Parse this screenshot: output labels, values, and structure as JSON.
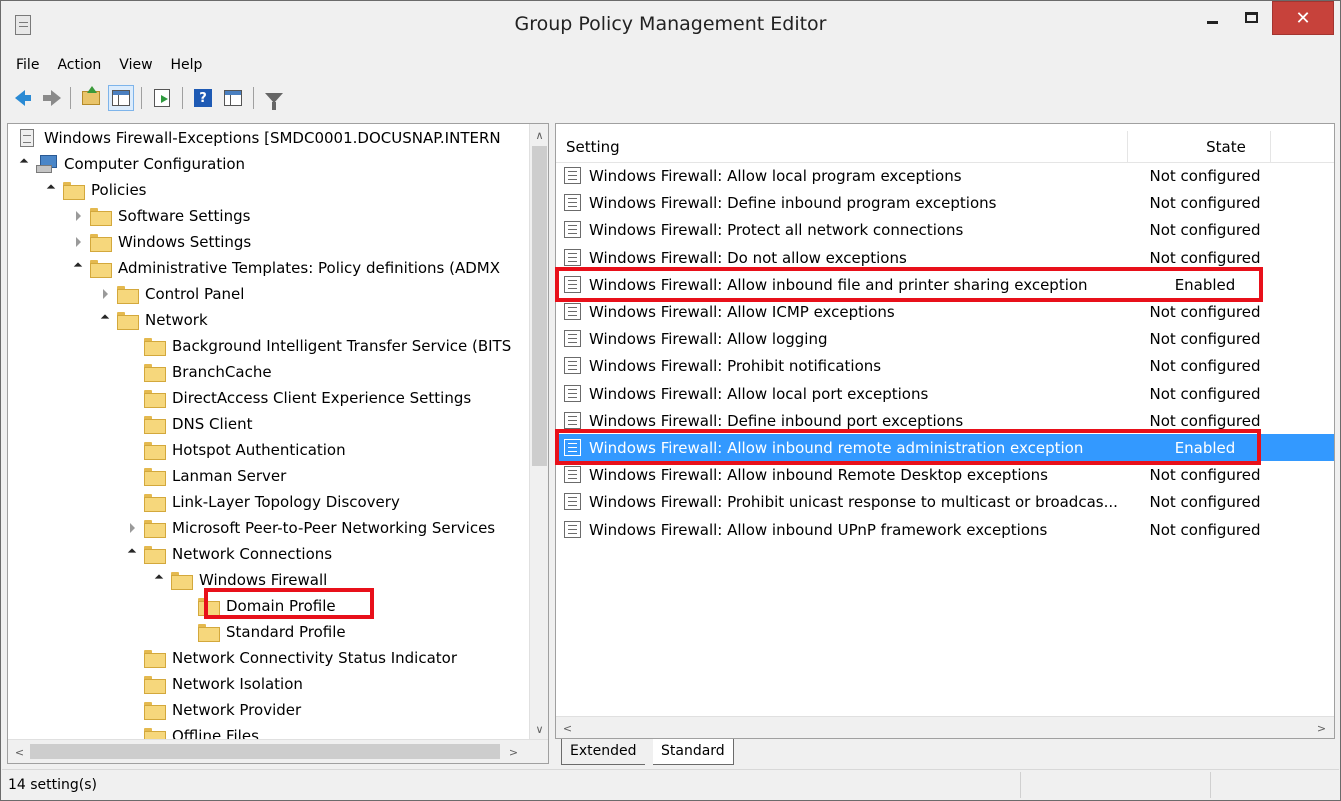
{
  "window": {
    "title": "Group Policy Management Editor",
    "close_glyph": "✕"
  },
  "menu": [
    "File",
    "Action",
    "View",
    "Help"
  ],
  "toolbar": {
    "help_glyph": "?"
  },
  "tree": {
    "items": [
      {
        "label": "Windows Firewall-Exceptions [SMDC0001.DOCUSNAP.INTERN",
        "icon": "gpo-icon",
        "expander": "none",
        "level": 0
      },
      {
        "label": "Computer Configuration",
        "icon": "computer-icon",
        "expander": "open",
        "level": 0
      },
      {
        "label": "Policies",
        "icon": "folder-icon",
        "expander": "open",
        "level": 1
      },
      {
        "label": "Software Settings",
        "icon": "folder-icon",
        "expander": "closed",
        "level": 2
      },
      {
        "label": "Windows Settings",
        "icon": "folder-icon",
        "expander": "closed",
        "level": 2
      },
      {
        "label": "Administrative Templates: Policy definitions (ADMX",
        "icon": "folder-icon",
        "expander": "open",
        "level": 2
      },
      {
        "label": "Control Panel",
        "icon": "folder-icon",
        "expander": "closed",
        "level": 3
      },
      {
        "label": "Network",
        "icon": "folder-icon",
        "expander": "open",
        "level": 3
      },
      {
        "label": "Background Intelligent Transfer Service (BITS",
        "icon": "folder-icon",
        "expander": "none",
        "level": 4
      },
      {
        "label": "BranchCache",
        "icon": "folder-icon",
        "expander": "none",
        "level": 4
      },
      {
        "label": "DirectAccess Client Experience Settings",
        "icon": "folder-icon",
        "expander": "none",
        "level": 4
      },
      {
        "label": "DNS Client",
        "icon": "folder-icon",
        "expander": "none",
        "level": 4
      },
      {
        "label": "Hotspot Authentication",
        "icon": "folder-icon",
        "expander": "none",
        "level": 4
      },
      {
        "label": "Lanman Server",
        "icon": "folder-icon",
        "expander": "none",
        "level": 4
      },
      {
        "label": "Link-Layer Topology Discovery",
        "icon": "folder-icon",
        "expander": "none",
        "level": 4
      },
      {
        "label": "Microsoft Peer-to-Peer Networking Services",
        "icon": "folder-icon",
        "expander": "closed",
        "level": 4
      },
      {
        "label": "Network Connections",
        "icon": "folder-icon",
        "expander": "open",
        "level": 4
      },
      {
        "label": "Windows Firewall",
        "icon": "folder-icon",
        "expander": "open",
        "level": 5
      },
      {
        "label": "Domain Profile",
        "icon": "folder-icon",
        "expander": "none",
        "level": 6
      },
      {
        "label": "Standard Profile",
        "icon": "folder-icon",
        "expander": "none",
        "level": 6
      },
      {
        "label": "Network Connectivity Status Indicator",
        "icon": "folder-icon",
        "expander": "none",
        "level": 4
      },
      {
        "label": "Network Isolation",
        "icon": "folder-icon",
        "expander": "none",
        "level": 4
      },
      {
        "label": "Network Provider",
        "icon": "folder-icon",
        "expander": "none",
        "level": 4
      },
      {
        "label": "Offline Files",
        "icon": "folder-icon",
        "expander": "none",
        "level": 4
      }
    ],
    "scroll_up_glyph": "∧",
    "scroll_down_glyph": "∨",
    "scroll_left_glyph": "<",
    "scroll_right_glyph": ">"
  },
  "list": {
    "columns": {
      "setting": "Setting",
      "state": "State"
    },
    "rows": [
      {
        "setting": "Windows Firewall: Allow local program exceptions",
        "state": "Not configured"
      },
      {
        "setting": "Windows Firewall: Define inbound program exceptions",
        "state": "Not configured"
      },
      {
        "setting": "Windows Firewall: Protect all network connections",
        "state": "Not configured"
      },
      {
        "setting": "Windows Firewall: Do not allow exceptions",
        "state": "Not configured"
      },
      {
        "setting": "Windows Firewall: Allow inbound file and printer sharing exception",
        "state": "Enabled"
      },
      {
        "setting": "Windows Firewall: Allow ICMP exceptions",
        "state": "Not configured"
      },
      {
        "setting": "Windows Firewall: Allow logging",
        "state": "Not configured"
      },
      {
        "setting": "Windows Firewall: Prohibit notifications",
        "state": "Not configured"
      },
      {
        "setting": "Windows Firewall: Allow local port exceptions",
        "state": "Not configured"
      },
      {
        "setting": "Windows Firewall: Define inbound port exceptions",
        "state": "Not configured"
      },
      {
        "setting": "Windows Firewall: Allow inbound remote administration exception",
        "state": "Enabled",
        "selected": true
      },
      {
        "setting": "Windows Firewall: Allow inbound Remote Desktop exceptions",
        "state": "Not configured"
      },
      {
        "setting": "Windows Firewall: Prohibit unicast response to multicast or broadcas...",
        "state": "Not configured"
      },
      {
        "setting": "Windows Firewall: Allow inbound UPnP framework exceptions",
        "state": "Not configured"
      }
    ],
    "scroll_left_glyph": "<",
    "scroll_right_glyph": ">"
  },
  "tabs": {
    "extended": "Extended",
    "standard": "Standard"
  },
  "status": {
    "text": "14 setting(s)"
  },
  "colors": {
    "selection": "#3399ff",
    "highlight_box": "#e8101a",
    "close_button": "#c7423b"
  }
}
